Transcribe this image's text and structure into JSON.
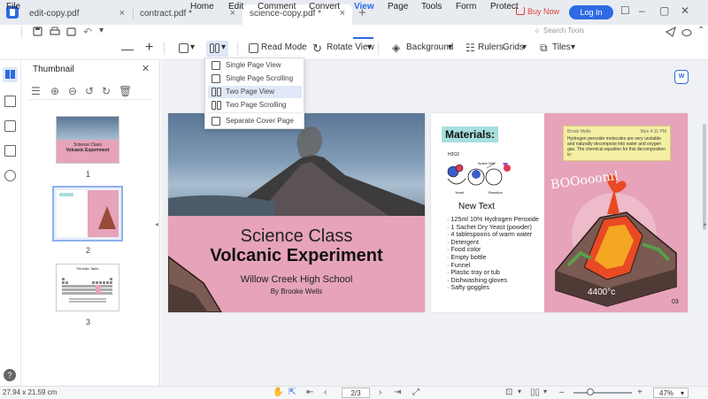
{
  "tabs": [
    {
      "label": "edit-copy.pdf"
    },
    {
      "label": "contract.pdf *"
    },
    {
      "label": "science-copy.pdf *",
      "active": true
    }
  ],
  "header": {
    "buy_now": "Buy Now",
    "login": "Log In"
  },
  "menu": {
    "file": "File",
    "items": [
      "Home",
      "Edit",
      "Comment",
      "Convert",
      "View",
      "Page",
      "Tools",
      "Form",
      "Protect"
    ],
    "active": "View",
    "search_placeholder": "Search Tools"
  },
  "toolbar": {
    "read_mode": "Read Mode",
    "rotate_view": "Rotate View",
    "background": "Background",
    "rulers": "Rulers",
    "grids": "Grids",
    "tiles": "Tiles"
  },
  "dropdown": {
    "items": [
      "Single Page View",
      "Single Page Scrolling",
      "Two Page View",
      "Two Page Scrolling",
      "Separate Cover Page"
    ],
    "selected": "Two Page View"
  },
  "thumbnail_panel": {
    "title": "Thumbnail",
    "pages": [
      "1",
      "2",
      "3"
    ],
    "selected_page": "2",
    "thumb1": {
      "line1": "Science Class",
      "line2": "Volcanic Experiment"
    },
    "thumb3": {
      "title": "Periodic Table"
    }
  },
  "left_page": {
    "title_line1": "Science Class",
    "title_line2": "Volcanic Experiment",
    "school": "Willow Creek High School",
    "author": "By Brooke Wells"
  },
  "right_page": {
    "materials_heading": "Materials:",
    "new_text": "New Text",
    "materials": [
      "125ml 10% Hydrogen Peroxide",
      "1 Sachet Dry Yeast (powder)",
      "4 tablespoons of warm water",
      "Detergent",
      "Food color",
      "Empty bottle",
      "Funnel",
      "Plastic tray or tub",
      "Dishwashing gloves",
      "Safty goggles"
    ],
    "sticky_note": {
      "author": "Brook Wells",
      "time": "Mon 4:11 PM",
      "text": "Hydrogen peroxide molecules are very unstable and naturally decompose into water and oxygen gas. The chemical equation for this decomposition is:"
    },
    "booo_text": "BOOooom!",
    "temperature": "4400°c",
    "diagram_labels": {
      "h2o2": "H2O2",
      "active_site": "Active Site",
      "yeast": "Yeast",
      "reaction": "Reaction"
    },
    "page_number": "03"
  },
  "statusbar": {
    "dimensions": "27.94 x 21.59 cm",
    "page_current": "2",
    "page_total": "/3",
    "zoom": "47%",
    "zoom_level": 0.47
  },
  "colors": {
    "accent": "#2d6ae3",
    "pink": "#e6a3b9",
    "teal_highlight": "#a8dedf",
    "sticky": "#f4efa3"
  }
}
